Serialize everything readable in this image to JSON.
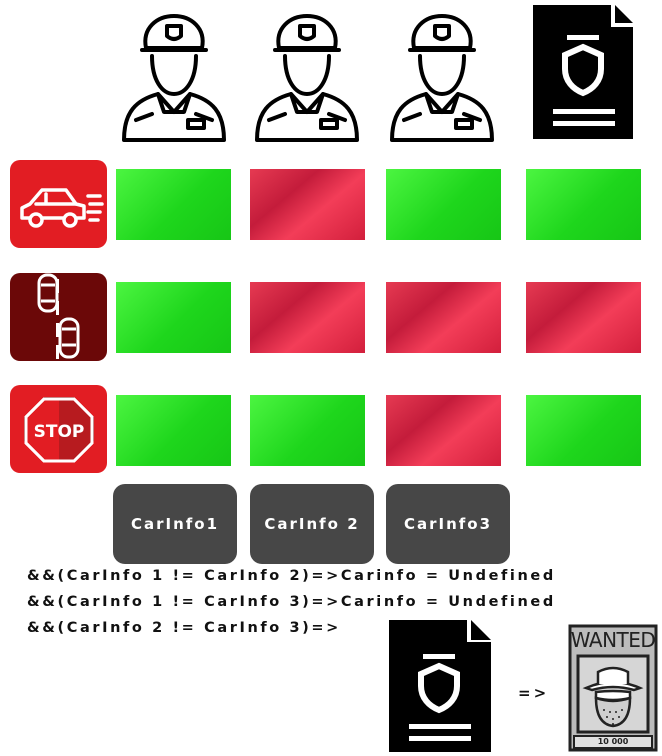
{
  "headers": [
    {
      "type": "officer",
      "icon": "police-officer-icon"
    },
    {
      "type": "officer",
      "icon": "police-officer-icon"
    },
    {
      "type": "officer",
      "icon": "police-officer-icon"
    },
    {
      "type": "document",
      "icon": "police-document-icon"
    }
  ],
  "rows": [
    {
      "icon": "speeding-car-icon",
      "cells": [
        "green",
        "red",
        "green",
        "green"
      ]
    },
    {
      "icon": "overtaking-cars-icon",
      "cells": [
        "green",
        "red",
        "red",
        "red"
      ]
    },
    {
      "icon": "stop-sign-icon",
      "icon_text": "STOP",
      "cells": [
        "green",
        "green",
        "red",
        "green"
      ]
    }
  ],
  "carinfo_labels": [
    "CarInfo1",
    "CarInfo 2",
    "CarInfo3"
  ],
  "code_lines": [
    "&&(CarInfo 1 != CarInfo 2)=>Carinfo = Undefined",
    "&&(CarInfo 1 != CarInfo 3)=>Carinfo = Undefined",
    "&&(CarInfo 2 != CarInfo 3)=>"
  ],
  "result": {
    "arrow": "=>",
    "poster_title": "WANTED",
    "poster_reward": "10 000",
    "poster_icon": "wanted-outlaw-icon",
    "document_icon": "police-document-icon"
  },
  "colors": {
    "green": "#22d81f",
    "red": "#d8203d",
    "dark": "#474747"
  }
}
